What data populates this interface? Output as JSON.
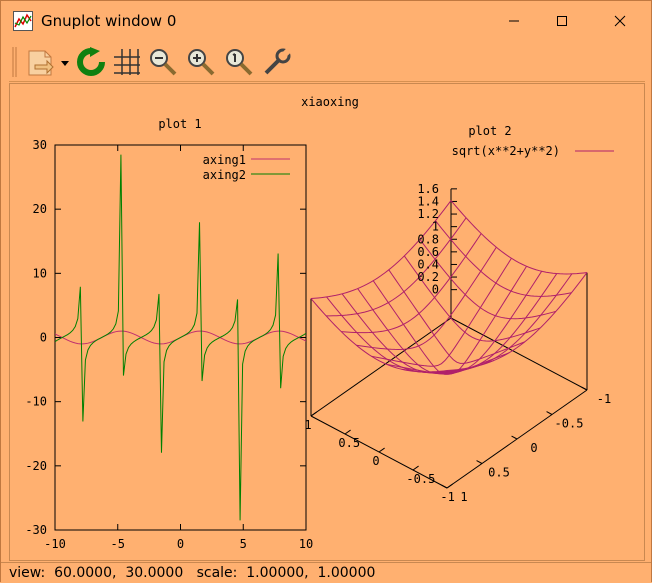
{
  "window": {
    "title": "Gnuplot window 0"
  },
  "toolbar": {
    "items": [
      "copy-icon",
      "replot-icon",
      "grid-icon",
      "zoom-out-icon",
      "zoom-in-icon",
      "zoom-reset-icon",
      "options-icon"
    ]
  },
  "figure": {
    "main_title": "xiaoxing"
  },
  "status": {
    "text": "view:  60.0000,  30.0000   scale:  1.00000,  1.00000"
  },
  "colors": {
    "background": "#ffb070",
    "series_1": "#c0306e",
    "series_2": "#008000",
    "surface": "#b0206a"
  },
  "chart_data": [
    {
      "type": "line",
      "title": "plot 1",
      "xlim": [
        -10,
        10
      ],
      "ylim": [
        -30,
        30
      ],
      "xticks": [
        "-10",
        "-5",
        "0",
        "5",
        "10"
      ],
      "yticks": [
        "-30",
        "-20",
        "-10",
        "0",
        "10",
        "20",
        "30"
      ],
      "legend_position": "top-right",
      "series": [
        {
          "name": "axing1",
          "function": "sin(x)"
        },
        {
          "name": "axing2",
          "function": "tan(x)"
        }
      ]
    },
    {
      "type": "surface",
      "title": "plot 2",
      "function": "sqrt(x**2+y**2)",
      "legend_position": "top-right",
      "xlim": [
        -1,
        1
      ],
      "ylim": [
        -1,
        1
      ],
      "zlim": [
        0,
        1.6
      ],
      "xticks": [
        "-1",
        "-0.5",
        "0",
        "0.5",
        "1"
      ],
      "yticks": [
        "-1",
        "-0.5",
        "0",
        "0.5",
        "1"
      ],
      "zticks": [
        "0",
        "0.2",
        "0.4",
        "0.6",
        "0.8",
        "1",
        "1.2",
        "1.4",
        "1.6"
      ],
      "series": [
        {
          "name": "sqrt(x**2+y**2)"
        }
      ]
    }
  ]
}
